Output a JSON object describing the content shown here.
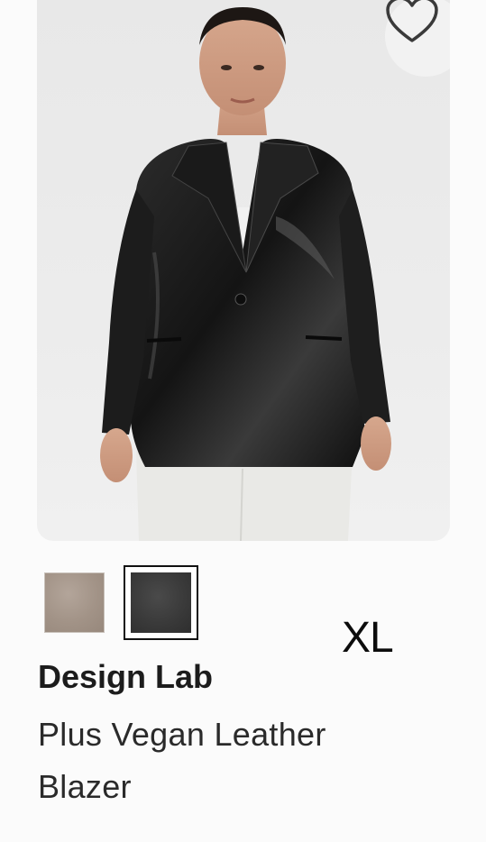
{
  "product": {
    "brand": "Design Lab",
    "title": "Plus Vegan Leather Blazer",
    "size": "XL",
    "favorite_icon": "heart-outline-icon",
    "image_alt": "Model wearing black vegan leather blazer with white top and white pants",
    "swatches": [
      {
        "name": "taupe",
        "color": "#a69689",
        "selected": false
      },
      {
        "name": "black",
        "color": "#3a3a3a",
        "selected": true
      }
    ]
  }
}
